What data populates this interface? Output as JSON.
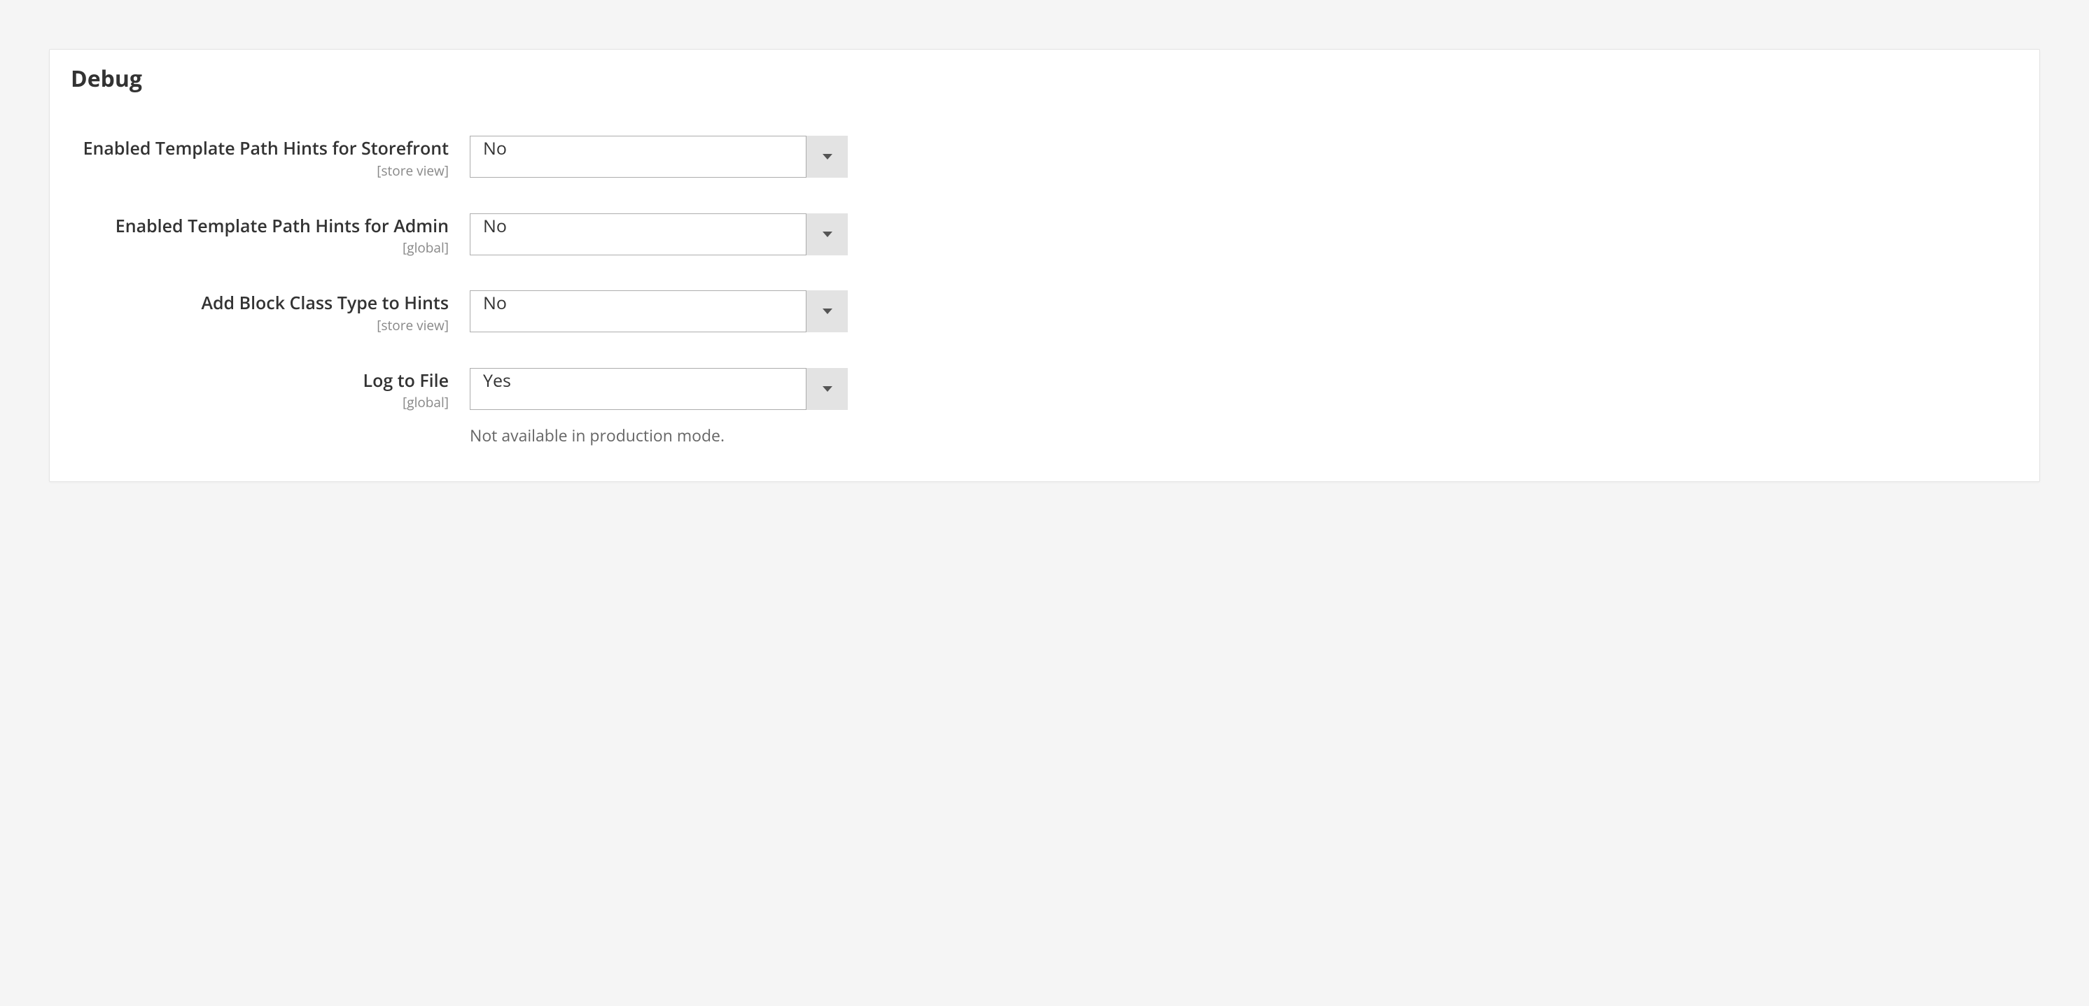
{
  "panel": {
    "title": "Debug",
    "fields": [
      {
        "label": "Enabled Template Path Hints for Storefront",
        "scope": "[store view]",
        "value": "No",
        "note": ""
      },
      {
        "label": "Enabled Template Path Hints for Admin",
        "scope": "[global]",
        "value": "No",
        "note": ""
      },
      {
        "label": "Add Block Class Type to Hints",
        "scope": "[store view]",
        "value": "No",
        "note": ""
      },
      {
        "label": "Log to File",
        "scope": "[global]",
        "value": "Yes",
        "note": "Not available in production mode."
      }
    ]
  }
}
